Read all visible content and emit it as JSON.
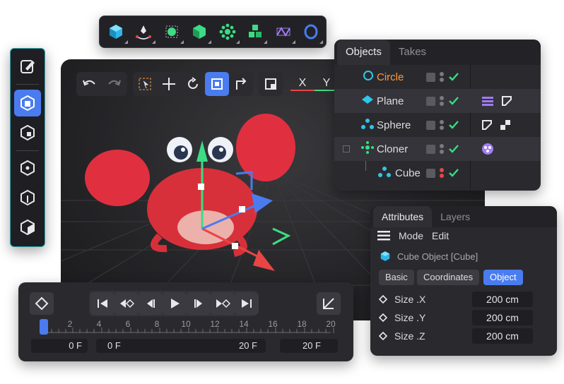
{
  "objects_panel": {
    "tabs": [
      "Objects",
      "Takes"
    ],
    "objects": [
      {
        "name": "Circle",
        "color": "#ff9a3c",
        "active": true
      },
      {
        "name": "Plane",
        "color": "#dcdce0"
      },
      {
        "name": "Sphere",
        "color": "#dcdce0"
      },
      {
        "name": "Cloner",
        "color": "#dcdce0"
      },
      {
        "name": "Cube",
        "color": "#dcdce0"
      }
    ]
  },
  "attributes_panel": {
    "tabs": [
      "Attributes",
      "Layers"
    ],
    "menu": [
      "Mode",
      "Edit"
    ],
    "object_title": "Cube Object [Cube]",
    "subtabs": [
      "Basic",
      "Coordinates",
      "Object"
    ],
    "active_subtab": "Object",
    "properties": [
      {
        "label": "Size .X",
        "value": "200 cm"
      },
      {
        "label": "Size .Y",
        "value": "200 cm"
      },
      {
        "label": "Size .Z",
        "value": "200 cm"
      }
    ]
  },
  "viewport": {
    "axis_x": "X",
    "axis_y": "Y"
  },
  "timeline": {
    "ticks": [
      "0",
      "2",
      "4",
      "6",
      "8",
      "10",
      "12",
      "14",
      "16",
      "18",
      "20"
    ],
    "current_frame": "0 F",
    "range_start": "0 F",
    "range_end": "20 F",
    "end_frame": "20 F"
  },
  "colors": {
    "accent": "#4a7cf0",
    "check": "#3ddc84",
    "cyan": "#2fc6e8",
    "red": "#e84545"
  }
}
